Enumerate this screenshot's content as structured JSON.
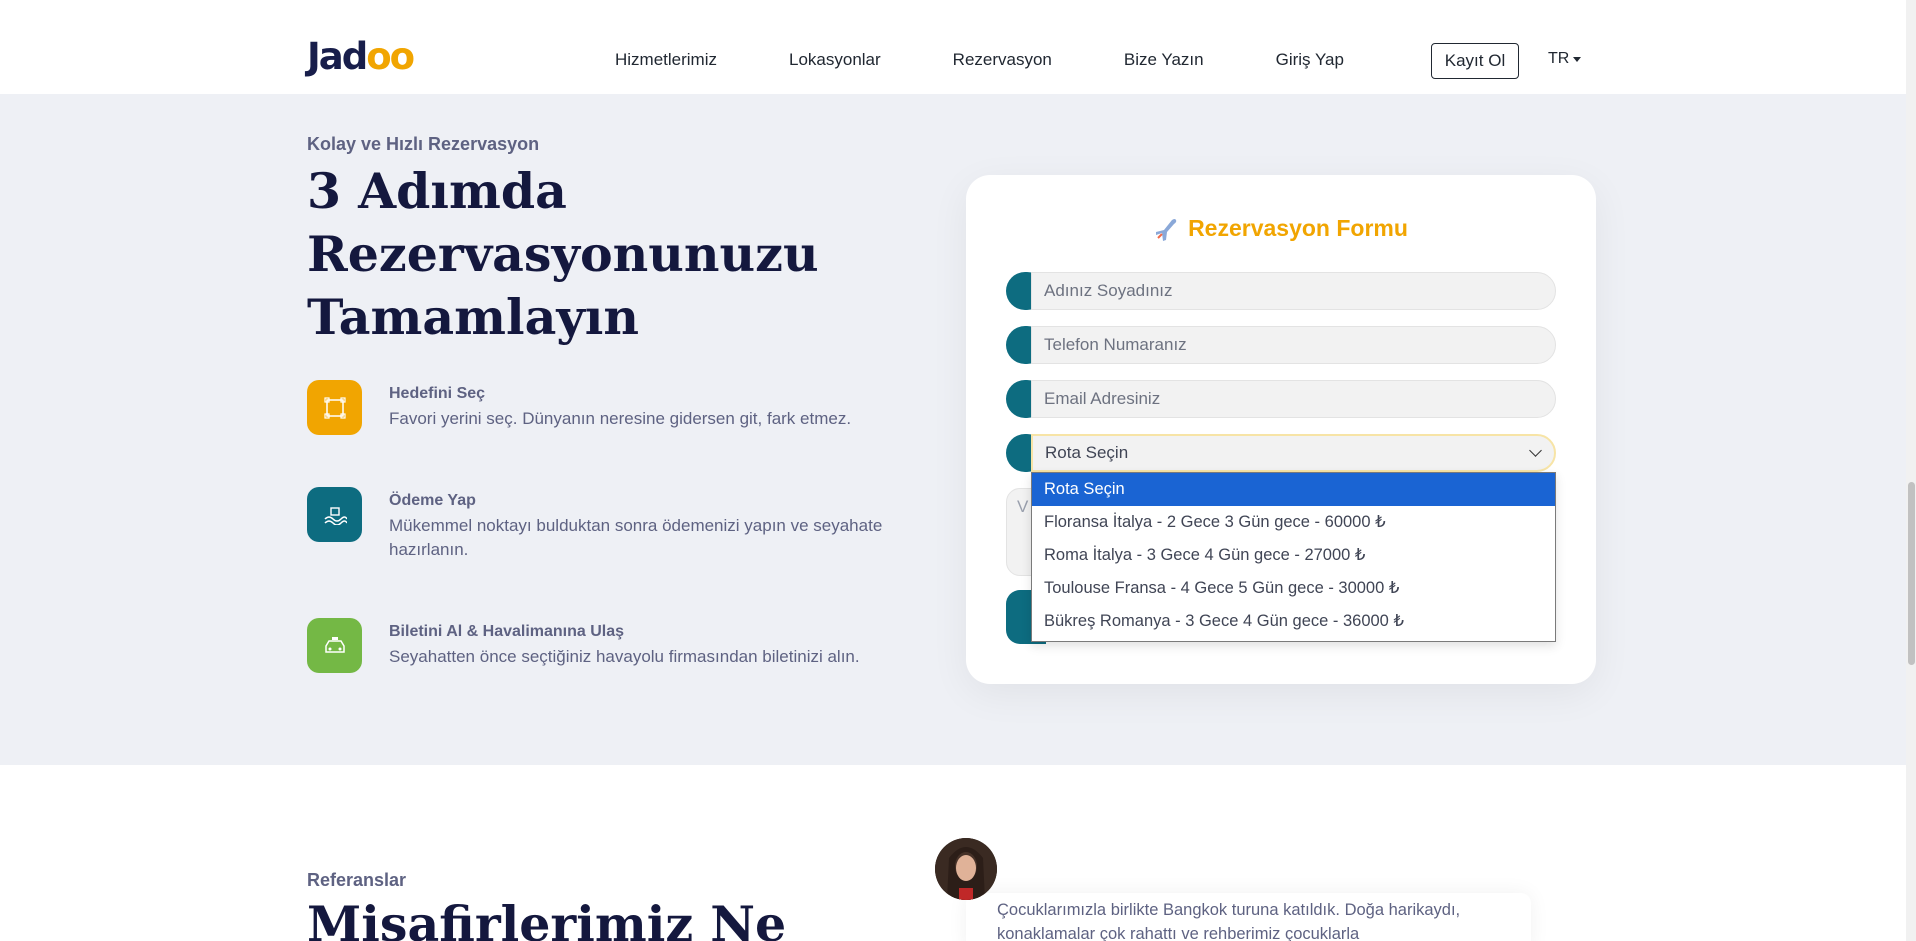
{
  "navbar": {
    "brand_prefix": "Jad",
    "brand_suffix": "oo",
    "links": [
      "Hizmetlerimiz",
      "Lokasyonlar",
      "Rezervasyon",
      "Bize Yazın",
      "Giriş Yap"
    ],
    "signup_label": "Kayıt Ol",
    "language": "TR"
  },
  "booking": {
    "eyebrow": "Kolay ve Hızlı Rezervasyon",
    "title": "3 Adımda Rezervasyonunuzu Tamamlayın",
    "steps": [
      {
        "title": "Hedefini Seç",
        "desc": "Favori yerini seç. Dünyanın neresine gidersen git, fark etmez.",
        "color": "#f1a501",
        "icon": "crop-icon"
      },
      {
        "title": "Ödeme Yap",
        "desc": "Mükemmel noktayı bulduktan sonra ödemenizi yapın ve seyahate hazırlanın.",
        "color": "#0d6c80",
        "icon": "water-icon"
      },
      {
        "title": "Biletini Al & Havalimanına Ulaş",
        "desc": "Seyahatten önce seçtiğiniz havayolu firmasından biletinizi alın.",
        "color": "#74b845",
        "icon": "taxi-icon"
      }
    ]
  },
  "form": {
    "title": "Rezervasyon Formu",
    "name_placeholder": "Adınız Soyadınız",
    "phone_placeholder": "Telefon Numaranız",
    "email_placeholder": "Email Adresiniz",
    "route_selected": "Rota Seçin",
    "route_options": [
      "Rota Seçin",
      "Floransa İtalya - 2 Gece 3 Gün gece - 60000 ₺",
      "Roma İtalya - 3 Gece 4 Gün gece - 27000 ₺",
      "Toulouse Fransa - 4 Gece 5 Gün gece - 30000 ₺",
      "Bükreş Romanya - 3 Gece 4 Gün gece - 36000 ₺"
    ],
    "textarea_partial": "V"
  },
  "references": {
    "eyebrow": "Referanslar",
    "title": "Misafirlerimiz Ne",
    "testimonial": "Çocuklarımızla birlikte Bangkok turuna katıldık. Doğa harikaydı, konaklamalar çok rahattı ve rehberimiz çocuklarla"
  },
  "colors": {
    "accent_yellow": "#f1a501",
    "accent_teal": "#0d6c80",
    "accent_green": "#74b845",
    "heading": "#14183e",
    "dropdown_selected": "#1a64d3"
  }
}
